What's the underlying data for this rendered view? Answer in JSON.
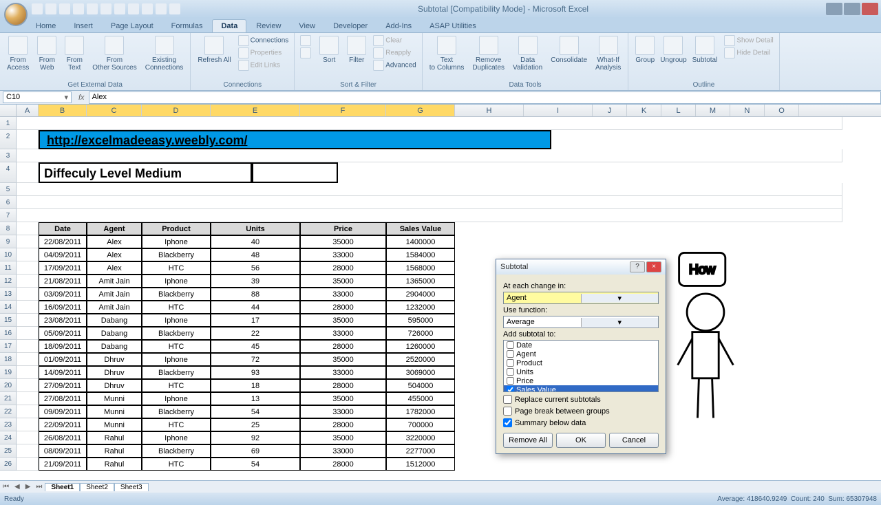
{
  "window": {
    "title": "Subtotal [Compatibility Mode] - Microsoft Excel"
  },
  "tabs": {
    "list": [
      "Home",
      "Insert",
      "Page Layout",
      "Formulas",
      "Data",
      "Review",
      "View",
      "Developer",
      "Add-Ins",
      "ASAP Utilities"
    ],
    "active": "Data"
  },
  "ribbon": {
    "g1": {
      "label": "Get External Data",
      "items": [
        "From Access",
        "From Web",
        "From Text",
        "From Other Sources",
        "Existing Connections"
      ]
    },
    "g2": {
      "label": "Connections",
      "refresh": "Refresh All",
      "c1": "Connections",
      "c2": "Properties",
      "c3": "Edit Links"
    },
    "g3": {
      "label": "Sort & Filter",
      "sort": "Sort",
      "filter": "Filter",
      "clear": "Clear",
      "reapply": "Reapply",
      "adv": "Advanced"
    },
    "g4": {
      "label": "Data Tools",
      "items": [
        "Text to Columns",
        "Remove Duplicates",
        "Data Validation",
        "Consolidate",
        "What-If Analysis"
      ]
    },
    "g5": {
      "label": "Outline",
      "items": [
        "Group",
        "Ungroup",
        "Subtotal"
      ],
      "sd": "Show Detail",
      "hd": "Hide Detail"
    }
  },
  "namebox": "C10",
  "formula": "Alex",
  "columns": [
    "A",
    "B",
    "C",
    "D",
    "E",
    "F",
    "G",
    "H",
    "I",
    "J",
    "K",
    "L",
    "M",
    "N",
    "O"
  ],
  "banner": "http://excelmadeeasy.weebly.com/",
  "difficulty": "Diffeculy Level   Medium",
  "headers": [
    "Date",
    "Agent",
    "Product",
    "Units",
    "Price",
    "Sales Value"
  ],
  "rows": [
    [
      "22/08/2011",
      "Alex",
      "Iphone",
      "40",
      "35000",
      "1400000"
    ],
    [
      "04/09/2011",
      "Alex",
      "Blackberry",
      "48",
      "33000",
      "1584000"
    ],
    [
      "17/09/2011",
      "Alex",
      "HTC",
      "56",
      "28000",
      "1568000"
    ],
    [
      "21/08/2011",
      "Amit Jain",
      "Iphone",
      "39",
      "35000",
      "1365000"
    ],
    [
      "03/09/2011",
      "Amit Jain",
      "Blackberry",
      "88",
      "33000",
      "2904000"
    ],
    [
      "16/09/2011",
      "Amit Jain",
      "HTC",
      "44",
      "28000",
      "1232000"
    ],
    [
      "23/08/2011",
      "Dabang",
      "Iphone",
      "17",
      "35000",
      "595000"
    ],
    [
      "05/09/2011",
      "Dabang",
      "Blackberry",
      "22",
      "33000",
      "726000"
    ],
    [
      "18/09/2011",
      "Dabang",
      "HTC",
      "45",
      "28000",
      "1260000"
    ],
    [
      "01/09/2011",
      "Dhruv",
      "Iphone",
      "72",
      "35000",
      "2520000"
    ],
    [
      "14/09/2011",
      "Dhruv",
      "Blackberry",
      "93",
      "33000",
      "3069000"
    ],
    [
      "27/09/2011",
      "Dhruv",
      "HTC",
      "18",
      "28000",
      "504000"
    ],
    [
      "27/08/2011",
      "Munni",
      "Iphone",
      "13",
      "35000",
      "455000"
    ],
    [
      "09/09/2011",
      "Munni",
      "Blackberry",
      "54",
      "33000",
      "1782000"
    ],
    [
      "22/09/2011",
      "Munni",
      "HTC",
      "25",
      "28000",
      "700000"
    ],
    [
      "26/08/2011",
      "Rahul",
      "Iphone",
      "92",
      "35000",
      "3220000"
    ],
    [
      "08/09/2011",
      "Rahul",
      "Blackberry",
      "69",
      "33000",
      "2277000"
    ],
    [
      "21/09/2011",
      "Rahul",
      "HTC",
      "54",
      "28000",
      "1512000"
    ]
  ],
  "dialog": {
    "title": "Subtotal",
    "l1": "At each change in:",
    "combo1": "Agent",
    "l2": "Use function:",
    "combo2": "Average",
    "l3": "Add subtotal to:",
    "list": [
      "Date",
      "Agent",
      "Product",
      "Units",
      "Price",
      "Sales Value"
    ],
    "chk1": "Replace current subtotals",
    "chk2": "Page break between groups",
    "chk3": "Summary below data",
    "btns": {
      "remove": "Remove All",
      "ok": "OK",
      "cancel": "Cancel"
    }
  },
  "sheets": [
    "Sheet1",
    "Sheet2",
    "Sheet3"
  ],
  "status": {
    "ready": "Ready",
    "avg": "Average: 418640.9249",
    "cnt": "Count: 240",
    "sum": "Sum: 65307948"
  }
}
